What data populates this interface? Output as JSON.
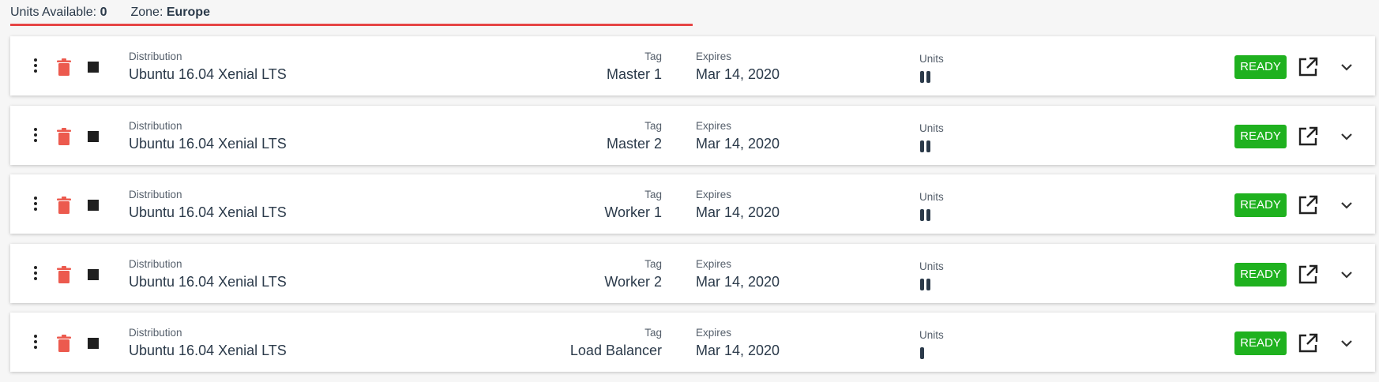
{
  "header": {
    "units_label": "Units Available:",
    "units_value": "0",
    "zone_label": "Zone:",
    "zone_value": "Europe"
  },
  "colors": {
    "ready_bg": "#1fb11f",
    "trash": "#ec5a4e",
    "header_underline": "#e64545"
  },
  "rows": [
    {
      "distribution_label": "Distribution",
      "distribution": "Ubuntu 16.04 Xenial LTS",
      "tag_label": "Tag",
      "tag": "Master 1",
      "expires_label": "Expires",
      "expires": "Mar 14, 2020",
      "units_label": "Units",
      "units": 2,
      "status": "READY"
    },
    {
      "distribution_label": "Distribution",
      "distribution": "Ubuntu 16.04 Xenial LTS",
      "tag_label": "Tag",
      "tag": "Master 2",
      "expires_label": "Expires",
      "expires": "Mar 14, 2020",
      "units_label": "Units",
      "units": 2,
      "status": "READY"
    },
    {
      "distribution_label": "Distribution",
      "distribution": "Ubuntu 16.04 Xenial LTS",
      "tag_label": "Tag",
      "tag": "Worker 1",
      "expires_label": "Expires",
      "expires": "Mar 14, 2020",
      "units_label": "Units",
      "units": 2,
      "status": "READY"
    },
    {
      "distribution_label": "Distribution",
      "distribution": "Ubuntu 16.04 Xenial LTS",
      "tag_label": "Tag",
      "tag": "Worker 2",
      "expires_label": "Expires",
      "expires": "Mar 14, 2020",
      "units_label": "Units",
      "units": 2,
      "status": "READY"
    },
    {
      "distribution_label": "Distribution",
      "distribution": "Ubuntu 16.04 Xenial LTS",
      "tag_label": "Tag",
      "tag": "Load Balancer",
      "expires_label": "Expires",
      "expires": "Mar 14, 2020",
      "units_label": "Units",
      "units": 1,
      "status": "READY"
    }
  ],
  "icons": {
    "menu": "kebab-menu-icon",
    "delete": "trash-icon",
    "stop": "stop-icon",
    "open": "external-link-icon",
    "expand": "chevron-down-icon"
  }
}
